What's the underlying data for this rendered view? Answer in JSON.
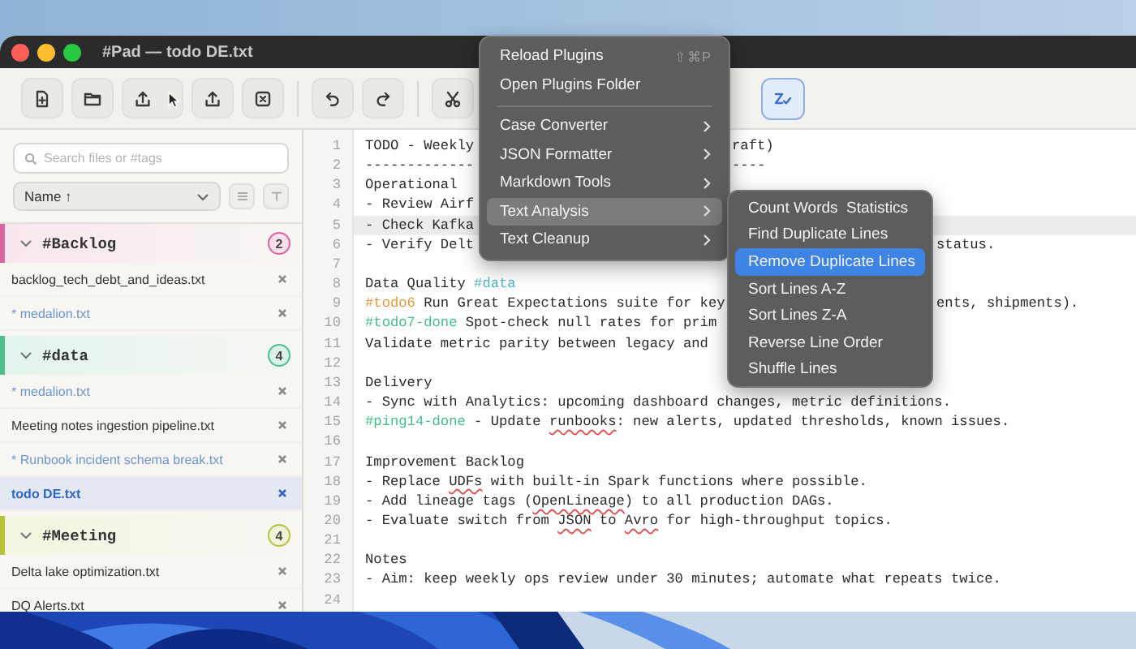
{
  "window": {
    "title": "#Pad — todo DE.txt"
  },
  "toolbar": {
    "spellcheck": {
      "on": true
    }
  },
  "sidebar": {
    "search": {
      "placeholder": "Search files or #tags"
    },
    "sort": {
      "value": "Name ↑"
    },
    "groups": [
      {
        "name": "#Backlog",
        "count": "2",
        "color": "#d9669e",
        "expanded": true,
        "files": [
          {
            "name": "backlog_tech_debt_and_ideas.txt",
            "modified": false,
            "selected": false
          },
          {
            "name": "* medalion.txt",
            "modified": true,
            "selected": false
          }
        ]
      },
      {
        "name": "#data",
        "count": "4",
        "color": "#4cbf8f",
        "expanded": true,
        "files": [
          {
            "name": "* medalion.txt",
            "modified": true,
            "selected": false
          },
          {
            "name": "Meeting notes ingestion pipeline.txt",
            "modified": false,
            "selected": false
          },
          {
            "name": "* Runbook incident schema break.txt",
            "modified": true,
            "selected": false
          },
          {
            "name": "todo DE.txt",
            "modified": false,
            "selected": true
          }
        ]
      },
      {
        "name": "#Meeting",
        "count": "4",
        "color": "#b5c43a",
        "expanded": true,
        "files": [
          {
            "name": "Delta lake optimization.txt",
            "modified": false,
            "selected": false
          },
          {
            "name": "DQ Alerts.txt",
            "modified": false,
            "selected": false
          }
        ]
      }
    ]
  },
  "editor": {
    "lines": [
      {
        "number": "1",
        "current": false,
        "parts": [
          {
            "kind": "plain",
            "text": "TODO - Weekly"
          },
          {
            "kind": "after-menu",
            "text": "raft)"
          }
        ]
      },
      {
        "number": "2",
        "current": false,
        "parts": [
          {
            "kind": "plain",
            "text": "-------------"
          },
          {
            "kind": "after-menu",
            "text": "----"
          }
        ]
      },
      {
        "number": "3",
        "current": false,
        "parts": [
          {
            "kind": "plain",
            "text": "Operational"
          }
        ]
      },
      {
        "number": "4",
        "current": false,
        "parts": [
          {
            "kind": "plain",
            "text": "- Review Airf"
          }
        ]
      },
      {
        "number": "5",
        "current": true,
        "parts": [
          {
            "kind": "plain",
            "text": "- Check Kafka"
          }
        ]
      },
      {
        "number": "6",
        "current": false,
        "parts": [
          {
            "kind": "plain",
            "text": "- Verify Delt"
          },
          {
            "kind": "after-submenu",
            "text": "status."
          }
        ]
      },
      {
        "number": "7",
        "current": false
      },
      {
        "number": "8",
        "current": false,
        "parts": [
          {
            "kind": "plain",
            "text": "Data Quality "
          },
          {
            "kind": "tag",
            "text": "#data",
            "color": "#4fb3c8"
          }
        ]
      },
      {
        "number": "9",
        "current": false,
        "parts": [
          {
            "kind": "tag",
            "text": "#todo6",
            "color": "#e5983a"
          },
          {
            "kind": "plain",
            "text": " Run Great Expectations suite for key"
          },
          {
            "kind": "after-submenu",
            "text": "ents, shipments)."
          }
        ]
      },
      {
        "number": "10",
        "current": false,
        "parts": [
          {
            "kind": "tag",
            "text": "#todo7-done",
            "color": "#3fbf88"
          },
          {
            "kind": "plain",
            "text": " Spot-check null rates for prim"
          }
        ]
      },
      {
        "number": "11",
        "current": false,
        "parts": [
          {
            "kind": "plain",
            "text": "Validate metric parity between legacy and"
          }
        ]
      },
      {
        "number": "12",
        "current": false
      },
      {
        "number": "13",
        "current": false,
        "parts": [
          {
            "kind": "plain",
            "text": "Delivery"
          }
        ]
      },
      {
        "number": "14",
        "current": false,
        "parts": [
          {
            "kind": "plain",
            "text": "- Sync with Analytics: upcoming dashboard changes, metric definitions."
          }
        ]
      },
      {
        "number": "15",
        "current": false,
        "parts": [
          {
            "kind": "tag",
            "text": "#ping14-done",
            "color": "#3fbf88"
          },
          {
            "kind": "plain",
            "text": " - Update "
          },
          {
            "kind": "misspelled",
            "text": "runbooks"
          },
          {
            "kind": "plain",
            "text": ": new alerts, updated thresholds, known issues."
          }
        ]
      },
      {
        "number": "16",
        "current": false
      },
      {
        "number": "17",
        "current": false,
        "parts": [
          {
            "kind": "plain",
            "text": "Improvement Backlog"
          }
        ]
      },
      {
        "number": "18",
        "current": false,
        "parts": [
          {
            "kind": "plain",
            "text": "- Replace "
          },
          {
            "kind": "misspelled",
            "text": "UDFs"
          },
          {
            "kind": "plain",
            "text": " with built-in Spark functions where possible."
          }
        ]
      },
      {
        "number": "19",
        "current": false,
        "parts": [
          {
            "kind": "plain",
            "text": "- Add lineage tags ("
          },
          {
            "kind": "misspelled",
            "text": "OpenLineage"
          },
          {
            "kind": "plain",
            "text": ") to all production DAGs."
          }
        ]
      },
      {
        "number": "20",
        "current": false,
        "parts": [
          {
            "kind": "plain",
            "text": "- Evaluate switch from "
          },
          {
            "kind": "misspelled",
            "text": "JSON"
          },
          {
            "kind": "plain",
            "text": " to "
          },
          {
            "kind": "misspelled",
            "text": "Avro"
          },
          {
            "kind": "plain",
            "text": " for high-throughput topics."
          }
        ]
      },
      {
        "number": "21",
        "current": false
      },
      {
        "number": "22",
        "current": false,
        "parts": [
          {
            "kind": "plain",
            "text": "Notes"
          }
        ]
      },
      {
        "number": "23",
        "current": false,
        "parts": [
          {
            "kind": "plain",
            "text": "- Aim: keep weekly ops review under 30 minutes; automate what repeats twice."
          }
        ]
      },
      {
        "number": "24",
        "current": false
      }
    ]
  },
  "plugins_menu": {
    "items": [
      {
        "kind": "command",
        "label": "Reload Plugins",
        "shortcut": "⇧⌘P",
        "selected": false
      },
      {
        "kind": "command",
        "label": "Open Plugins Folder",
        "selected": false
      },
      {
        "kind": "separator"
      },
      {
        "kind": "submenu",
        "label": "Case Converter",
        "selected": false
      },
      {
        "kind": "submenu",
        "label": "JSON Formatter",
        "selected": false
      },
      {
        "kind": "submenu",
        "label": "Markdown Tools",
        "selected": false
      },
      {
        "kind": "submenu",
        "label": "Text Analysis",
        "selected": true
      },
      {
        "kind": "submenu",
        "label": "Text Cleanup",
        "selected": false
      }
    ]
  },
  "text_analysis_submenu": {
    "items": [
      {
        "kind": "command",
        "label": "Count Words  Statistics",
        "selected": false
      },
      {
        "kind": "command",
        "label": "Find Duplicate Lines",
        "selected": false
      },
      {
        "kind": "command",
        "label": "Remove Duplicate Lines",
        "selected": true
      },
      {
        "kind": "command",
        "label": "Sort Lines A-Z",
        "selected": false
      },
      {
        "kind": "command",
        "label": "Sort Lines Z-A",
        "selected": false
      },
      {
        "kind": "command",
        "label": "Reverse Line Order",
        "selected": false
      },
      {
        "kind": "command",
        "label": "Shuffle Lines",
        "selected": false
      }
    ]
  }
}
